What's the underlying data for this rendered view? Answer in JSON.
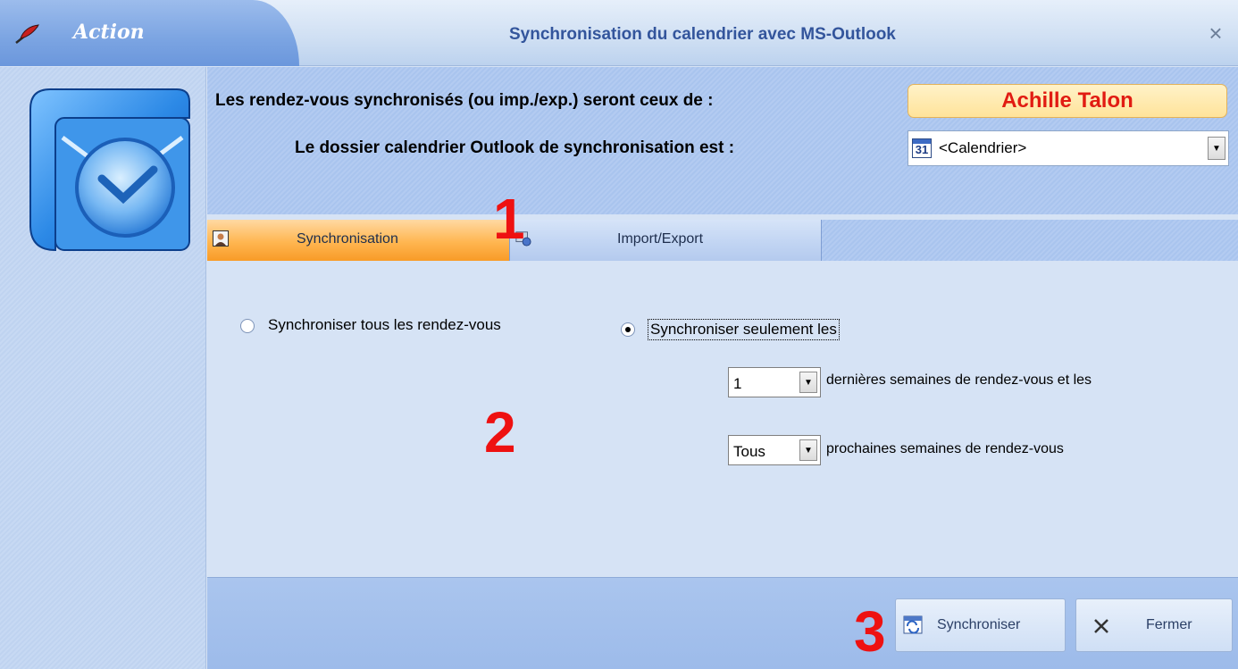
{
  "window": {
    "action_label": "Action",
    "title": "Synchronisation du calendrier avec MS-Outlook",
    "close_glyph": "×"
  },
  "header": {
    "appointments_label": "Les rendez-vous synchronisés (ou imp./exp.) seront ceux de :",
    "owner_name": "Achille Talon",
    "folder_label": "Le dossier calendrier Outlook de synchronisation est :",
    "folder_value": "<Calendrier>",
    "folder_icon_text": "31"
  },
  "tabs": [
    {
      "label": "Synchronisation",
      "active": true
    },
    {
      "label": "Import/Export",
      "active": false
    }
  ],
  "sync_options": {
    "all_label": "Synchroniser tous les rendez-vous",
    "only_label": "Synchroniser seulement les",
    "selected": "only",
    "past_weeks_value": "1",
    "past_weeks_text": "dernières semaines de rendez-vous et les",
    "next_weeks_value": "Tous",
    "next_weeks_text": "prochaines semaines de rendez-vous"
  },
  "buttons": {
    "sync_label": "Synchroniser",
    "close_label": "Fermer"
  },
  "annotations": [
    "1",
    "2",
    "3"
  ],
  "colors": {
    "accent_orange": "#ffb650",
    "owner_name": "#e11b12",
    "annotation_red": "#ee1111",
    "title_blue": "#33559c"
  },
  "icons": [
    "feather-icon",
    "outlook-logo-icon",
    "calendar-icon",
    "person-icon",
    "import-export-icon",
    "sync-icon",
    "close-x-icon"
  ]
}
